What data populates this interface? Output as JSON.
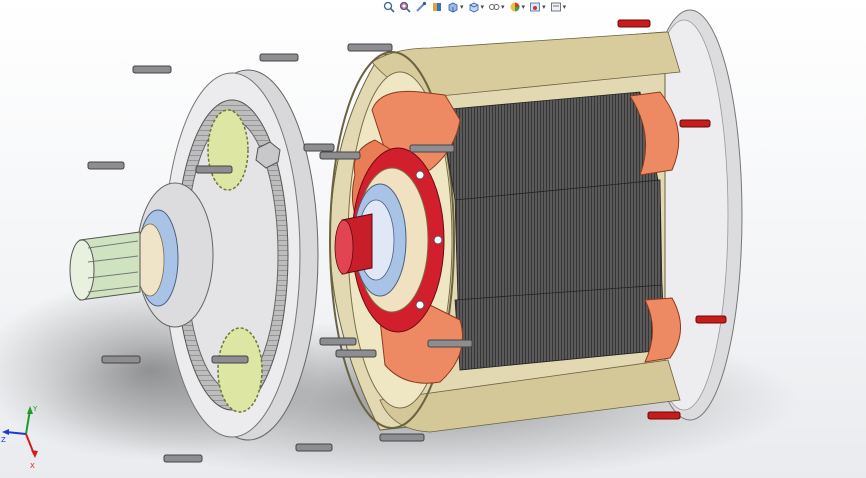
{
  "window": {
    "app": "SolidWorks 3D viewport",
    "background_top": "#ffffff",
    "background_bottom": "#e9ebee"
  },
  "hud_toolbar": {
    "items": [
      {
        "icon": "zoom-to-fit-icon",
        "has_dropdown": false
      },
      {
        "icon": "zoom-to-area-icon",
        "has_dropdown": false
      },
      {
        "icon": "previous-view-icon",
        "has_dropdown": false
      },
      {
        "icon": "section-view-icon",
        "has_dropdown": false
      },
      {
        "icon": "view-orientation-icon",
        "has_dropdown": true
      },
      {
        "icon": "display-style-icon",
        "has_dropdown": true
      },
      {
        "icon": "hide-show-items-icon",
        "has_dropdown": true
      },
      {
        "icon": "edit-appearance-icon",
        "has_dropdown": true
      },
      {
        "icon": "apply-scene-icon",
        "has_dropdown": true
      },
      {
        "icon": "view-settings-icon",
        "has_dropdown": true
      }
    ]
  },
  "triad": {
    "x_label": "X",
    "y_label": "Y",
    "z_label": "Z",
    "x_color": "#d21e1e",
    "y_color": "#1e9a2a",
    "z_color": "#1e3ad2"
  },
  "model": {
    "name": "exploded gear motor assembly",
    "colors": {
      "housing_face": "#ececec",
      "housing_edge": "#b9b9bd",
      "stator_shell": "#e6dcb6",
      "stator_shell_dark": "#c9bc8d",
      "winding_copper": "#f08b66",
      "winding_copper_dark": "#c8613f",
      "lamination": "#333333",
      "rotor_red": "#c81e2a",
      "bearing_blue": "#a8c2e6",
      "bearing_ring": "#f0e4c8",
      "gear_green": "#dfe6a8",
      "gear_teeth": "#9a9a9a",
      "shaft_green": "#cfe3c0",
      "bolt": "#8c8c90",
      "bolt_tip_red": "#d11a1a"
    }
  }
}
